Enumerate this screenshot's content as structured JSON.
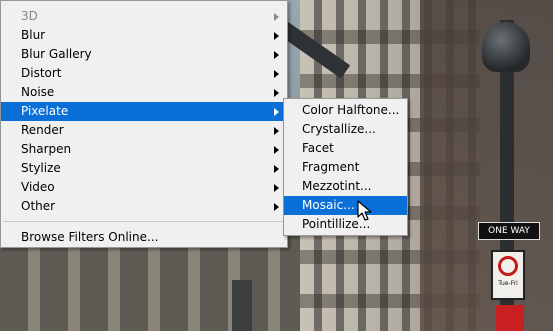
{
  "filter_menu": {
    "items": [
      {
        "label": "3D",
        "enabled": false,
        "has_submenu": true
      },
      {
        "label": "Blur",
        "enabled": true,
        "has_submenu": true
      },
      {
        "label": "Blur Gallery",
        "enabled": true,
        "has_submenu": true
      },
      {
        "label": "Distort",
        "enabled": true,
        "has_submenu": true
      },
      {
        "label": "Noise",
        "enabled": true,
        "has_submenu": true
      },
      {
        "label": "Pixelate",
        "enabled": true,
        "has_submenu": true,
        "selected": true
      },
      {
        "label": "Render",
        "enabled": true,
        "has_submenu": true
      },
      {
        "label": "Sharpen",
        "enabled": true,
        "has_submenu": true
      },
      {
        "label": "Stylize",
        "enabled": true,
        "has_submenu": true
      },
      {
        "label": "Video",
        "enabled": true,
        "has_submenu": true
      },
      {
        "label": "Other",
        "enabled": true,
        "has_submenu": true
      }
    ],
    "browse_online": "Browse Filters Online..."
  },
  "pixelate_submenu": {
    "items": [
      {
        "label": "Color Halftone..."
      },
      {
        "label": "Crystallize..."
      },
      {
        "label": "Facet"
      },
      {
        "label": "Fragment"
      },
      {
        "label": "Mezzotint..."
      },
      {
        "label": "Mosaic...",
        "selected": true
      },
      {
        "label": "Pointillize..."
      }
    ]
  },
  "background_sign": {
    "text": "ONE WAY",
    "sign_text": "Tue-Fri"
  },
  "colors": {
    "highlight": "#0a6fd6",
    "menu_bg": "#f0f0f0",
    "disabled_text": "#8a8a8a"
  },
  "cursor": {
    "icon": "arrow-pointer"
  }
}
